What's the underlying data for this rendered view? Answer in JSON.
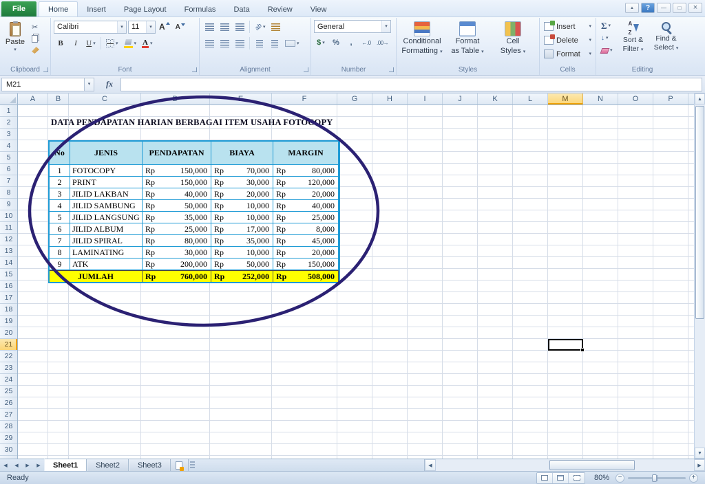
{
  "window": {
    "tabs": [
      "File",
      "Home",
      "Insert",
      "Page Layout",
      "Formulas",
      "Data",
      "Review",
      "View"
    ],
    "active_tab": "Home"
  },
  "icons": {
    "dropdown": "▾",
    "cut": "✂",
    "bold": "B",
    "italic": "I",
    "underline": "U",
    "grow_font": "A",
    "shrink_font": "A",
    "orientation": "ab",
    "dollar": "$",
    "percent": "%",
    "comma": ",",
    "inc_decimal": "←.0",
    "dec_decimal": ".00→",
    "sigma": "Σ",
    "fill_down": "↓",
    "collapse": "▲",
    "help": "?",
    "minimize": "—",
    "maximize": "□",
    "close": "×",
    "nav_prev": "◀",
    "nav_next": "▶",
    "up": "▲",
    "down": "▼",
    "left": "◀",
    "right": "▶",
    "minus": "−",
    "plus": "+"
  },
  "ribbon": {
    "clipboard": {
      "label": "Clipboard",
      "paste": "Paste"
    },
    "font": {
      "label": "Font",
      "font_name": "Calibri",
      "font_size": "11"
    },
    "alignment": {
      "label": "Alignment"
    },
    "number": {
      "label": "Number",
      "format": "General"
    },
    "styles": {
      "label": "Styles",
      "buttons": [
        [
          "Conditional",
          "Formatting"
        ],
        [
          "Format",
          "as Table"
        ],
        [
          "Cell",
          "Styles"
        ]
      ]
    },
    "cells": {
      "label": "Cells",
      "buttons": [
        "Insert",
        "Delete",
        "Format"
      ]
    },
    "editing": {
      "label": "Editing",
      "buttons": [
        [
          "Sort &",
          "Filter"
        ],
        [
          "Find &",
          "Select"
        ]
      ]
    }
  },
  "formula_bar": {
    "name_box": "M21",
    "fx": "fx",
    "value": ""
  },
  "grid": {
    "columns": [
      "A",
      "B",
      "C",
      "D",
      "E",
      "F",
      "G",
      "H",
      "I",
      "J",
      "K",
      "L",
      "M",
      "N",
      "O",
      "P"
    ],
    "row_count": 30,
    "selected_column": "M",
    "selected_row": 21,
    "active_cell": "M21"
  },
  "sheet": {
    "title": "DATA PENDAPATAN HARIAN BERBAGAI ITEM USAHA FOTOCOPY",
    "table": {
      "columns": [
        "No",
        "JENIS",
        "PENDAPATAN",
        "BIAYA",
        "MARGIN"
      ],
      "currency": "Rp",
      "rows": [
        [
          "1",
          "FOTOCOPY",
          "150,000",
          "70,000",
          "80,000"
        ],
        [
          "2",
          "PRINT",
          "150,000",
          "30,000",
          "120,000"
        ],
        [
          "3",
          "JILID LAKBAN",
          "40,000",
          "20,000",
          "20,000"
        ],
        [
          "4",
          "JILID SAMBUNG",
          "50,000",
          "10,000",
          "40,000"
        ],
        [
          "5",
          "JILID LANGSUNG",
          "35,000",
          "10,000",
          "25,000"
        ],
        [
          "6",
          "JILID ALBUM",
          "25,000",
          "17,000",
          "8,000"
        ],
        [
          "7",
          "JILID SPIRAL",
          "80,000",
          "35,000",
          "45,000"
        ],
        [
          "8",
          "LAMINATING",
          "30,000",
          "10,000",
          "20,000"
        ],
        [
          "9",
          "ATK",
          "200,000",
          "50,000",
          "150,000"
        ]
      ],
      "total": {
        "label": "JUMLAH",
        "values": [
          "760,000",
          "252,000",
          "508,000"
        ]
      }
    }
  },
  "sheet_tabs": {
    "names": [
      "Sheet1",
      "Sheet2",
      "Sheet3"
    ],
    "active": "Sheet1"
  },
  "status_bar": {
    "mode": "Ready",
    "zoom": "80%"
  },
  "colors": {
    "table_border": "#1f9bd5",
    "table_header_fill": "#b9e2ef",
    "total_row_fill": "#ffff00",
    "ellipse": "#2b2173",
    "selected_header": "#fbd576",
    "file_tab": "#1e7a3c"
  }
}
